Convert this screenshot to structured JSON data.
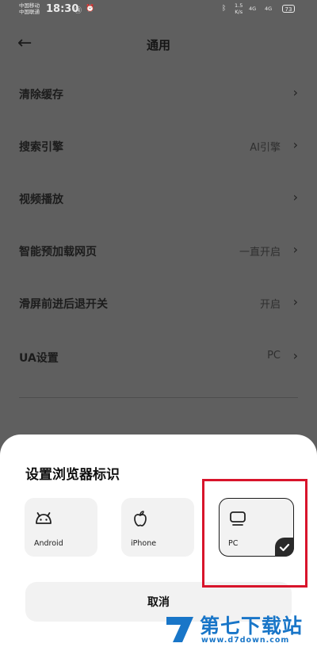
{
  "status": {
    "carrier1": "中国移动",
    "carrier2": "中国联通",
    "time": "18:30",
    "net_speed": "1.5",
    "net_unit": "K/s",
    "sig1": "4G",
    "sig2": "4G",
    "battery": "73"
  },
  "header": {
    "back_icon": "arrow-left-icon",
    "title": "通用"
  },
  "settings": [
    {
      "label": "清除缓存",
      "value": ""
    },
    {
      "label": "搜索引擎",
      "value": "AI引擎"
    },
    {
      "label": "视频播放",
      "value": ""
    },
    {
      "label": "智能预加载网页",
      "value": "一直开启"
    },
    {
      "label": "滑屏前进后退开关",
      "value": "开启"
    },
    {
      "label": "UA设置",
      "value": "PC"
    }
  ],
  "sheet": {
    "title": "设置浏览器标识",
    "options": [
      {
        "label": "Android",
        "icon": "android-icon",
        "selected": false
      },
      {
        "label": "iPhone",
        "icon": "apple-icon",
        "selected": false
      },
      {
        "label": "PC",
        "icon": "monitor-icon",
        "selected": true
      }
    ],
    "cancel_label": "取消"
  },
  "watermark": {
    "text": "第七下载站",
    "url": "www.d7down.com"
  },
  "colors": {
    "highlight": "#d8142b",
    "watermark": "#1976c8",
    "overlay": "#5f5f5f"
  }
}
